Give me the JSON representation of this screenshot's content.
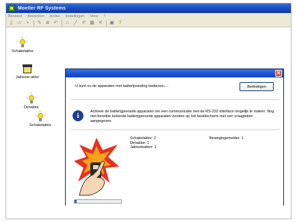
{
  "window": {
    "title": "Moeller RF Systems"
  },
  "menu": [
    "Bestand",
    "Bewerken",
    "Acties",
    "Instellingen",
    "View",
    "?"
  ],
  "toolbar": {
    "icons": [
      "new-icon",
      "open-icon",
      "save-icon",
      "edit-icon",
      "list-icon",
      "undo-icon",
      "device-icon",
      "wand-icon",
      "brush-icon",
      "grid-icon",
      "delete-icon",
      "window-icon",
      "help-icon"
    ]
  },
  "devices": [
    {
      "label": "Schakelaktor",
      "icon": "bulb-icon"
    },
    {
      "label": "Jaloezie-aktor",
      "icon": "blind-icon"
    },
    {
      "label": "Dimaktor",
      "icon": "bulb-icon"
    },
    {
      "label": "Schakelaktor",
      "icon": "bulb-icon"
    }
  ],
  "dialog": {
    "close_symbol": "✕",
    "message": "U kunt nu de apparaten met batterijvoeding bedienen....",
    "end_button": "Beëindigen",
    "info_text": "Activeer de batterijgevoede apparaten om een communicatie met de RS-232 interface mogelijk te maken. Nog niet bereikte bekende batterijgevoede apparaten worden op het beeldscherm met een vraagteken aangegeven.",
    "counts": {
      "switch": "Schakelaktor: 2",
      "dimmer": "Dimaktor: 1",
      "blind": "Jaloezieaktor: 1",
      "motion": "Bewegingsmelder: 1"
    },
    "progress_fraction": 0.04
  },
  "colors": {
    "title_blue": "#1c4fc4",
    "dialog_bg": "#ece9d8",
    "close_red": "#d9512c",
    "info_blue": "#1d3f8f"
  }
}
